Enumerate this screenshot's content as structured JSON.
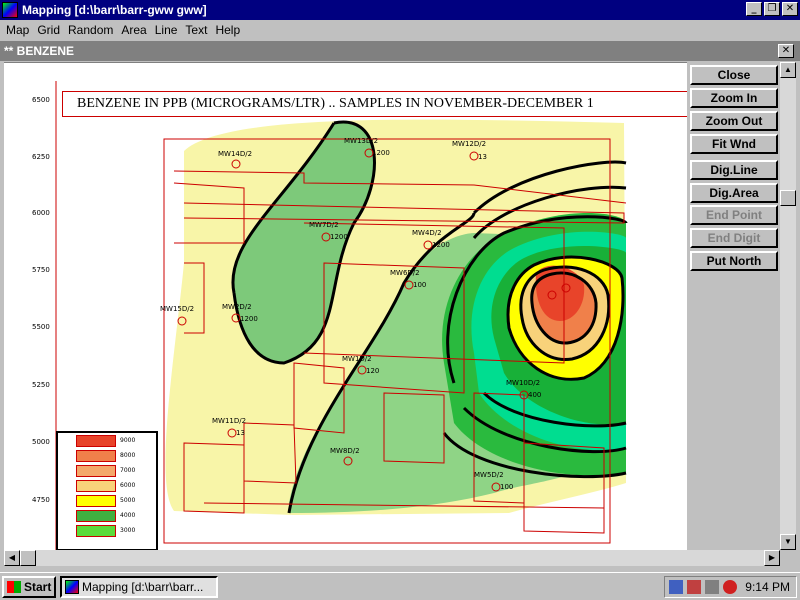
{
  "window": {
    "title": "Mapping [d:\\barr\\barr-gww gww]"
  },
  "menu": [
    "Map",
    "Grid",
    "Random",
    "Area",
    "Line",
    "Text",
    "Help"
  ],
  "child_window": {
    "title": "** BENZENE"
  },
  "map": {
    "title": "BENZENE IN PPB (MICROGRAMS/LTR) .. SAMPLES IN NOVEMBER-DECEMBER 1",
    "y_ticks": [
      "6500",
      "6250",
      "6000",
      "5750",
      "5500",
      "5250",
      "5000",
      "4750"
    ],
    "wells": [
      {
        "label": "MW14D/2",
        "value": ""
      },
      {
        "label": "MW13D/2",
        "value": "1200"
      },
      {
        "label": "MW12D/2",
        "value": "13"
      },
      {
        "label": "MW7D/2",
        "value": "1200"
      },
      {
        "label": "MW4D/2",
        "value": "1200"
      },
      {
        "label": "MW6D/2",
        "value": "100"
      },
      {
        "label": "MW15D/2",
        "value": ""
      },
      {
        "label": "MW2D/2",
        "value": "1200"
      },
      {
        "label": "MW1D/2",
        "value": "120"
      },
      {
        "label": "MW10D/2",
        "value": "400"
      },
      {
        "label": "MW11D/2",
        "value": "13"
      },
      {
        "label": "MW8D/2",
        "value": ""
      },
      {
        "label": "MW5D/2",
        "value": "100"
      }
    ],
    "legend": [
      {
        "label": "9000",
        "color": "#e8442a"
      },
      {
        "label": "8000",
        "color": "#f0804a"
      },
      {
        "label": "7000",
        "color": "#f4a86a"
      },
      {
        "label": "6000",
        "color": "#f8d27a"
      },
      {
        "label": "5000",
        "color": "#ffff00"
      },
      {
        "label": "4000",
        "color": "#40b040"
      },
      {
        "label": "3000",
        "color": "#5adc3a"
      }
    ]
  },
  "side_buttons": [
    {
      "label": "Close",
      "enabled": true
    },
    {
      "label": "Zoom In",
      "enabled": true
    },
    {
      "label": "Zoom Out",
      "enabled": true
    },
    {
      "label": "Fit Wnd",
      "enabled": true
    },
    {
      "label": "Dig.Line",
      "enabled": true
    },
    {
      "label": "Dig.Area",
      "enabled": true
    },
    {
      "label": "End Point",
      "enabled": false
    },
    {
      "label": "End Digit",
      "enabled": false
    },
    {
      "label": "Put North",
      "enabled": true
    }
  ],
  "taskbar": {
    "start_label": "Start",
    "task_label": "Mapping [d:\\barr\\barr...",
    "clock": "9:14 PM"
  }
}
